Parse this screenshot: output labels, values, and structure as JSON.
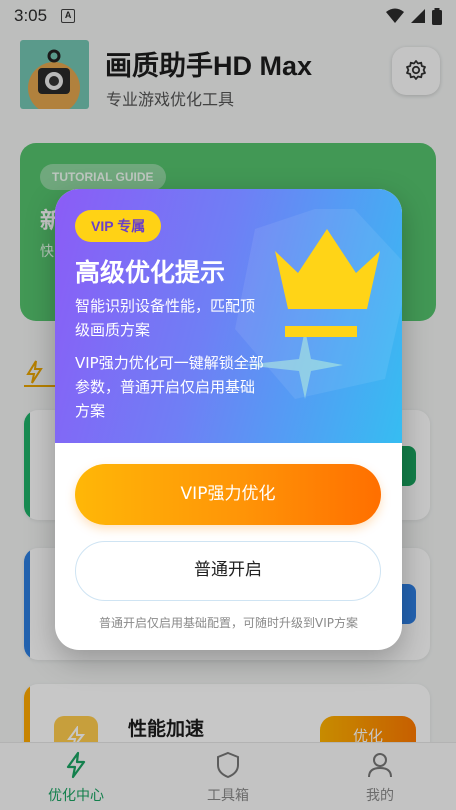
{
  "status": {
    "time": "3:05",
    "notif_icon": "a-icon",
    "wifi_icon": "wifi-icon",
    "signal_icon": "signal-icon",
    "battery_icon": "battery-icon"
  },
  "header": {
    "title": "画质助手HD Max",
    "subtitle": "专业游戏优化工具",
    "settings_icon": "gear-icon"
  },
  "tutorial": {
    "badge": "TUTORIAL GUIDE",
    "title": "新",
    "desc": "快"
  },
  "cards": [
    {
      "stripe_color": "#1fb36a",
      "button_color": "#18a35e"
    },
    {
      "stripe_color": "#2d7fe0",
      "button_color": "#2f80e6"
    },
    {
      "stripe_color": "#ffaa00",
      "title": "性能加速",
      "button_label": "优化",
      "icon": "bolt-icon"
    }
  ],
  "tabs": [
    {
      "label": "优化中心",
      "icon": "bolt-icon",
      "active": true
    },
    {
      "label": "工具箱",
      "icon": "shield-icon",
      "active": false
    },
    {
      "label": "我的",
      "icon": "user-icon",
      "active": false
    }
  ],
  "modal": {
    "badge": "VIP 专属",
    "title": "高级优化提示",
    "line1": "智能识别设备性能，匹配顶级画质方案",
    "line2": "VIP强力优化可一键解锁全部参数，普通开启仅启用基础方案",
    "vip_button": "VIP强力优化",
    "normal_button": "普通开启",
    "note": "普通开启仅启用基础配置，可随时升级到VIP方案",
    "decoration_icon": "crown-icon"
  },
  "colors": {
    "accent_green": "#1aa463",
    "vip_yellow": "#ffd215",
    "vip_orange": "#ff8a00",
    "gradient_purple": "#8b5cf6",
    "gradient_blue": "#36bdf2"
  }
}
